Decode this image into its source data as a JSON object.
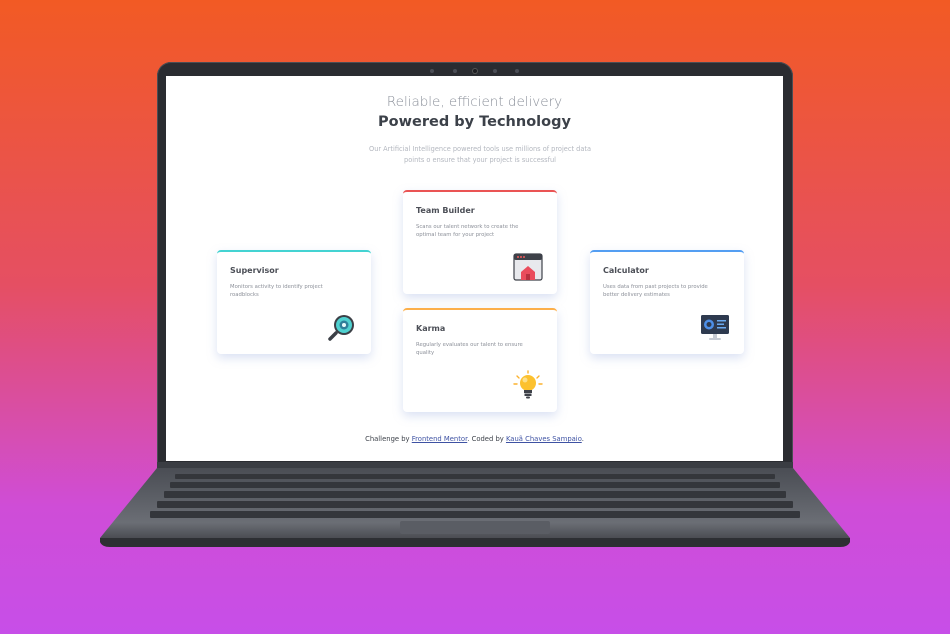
{
  "header": {
    "subtitle": "Reliable, efficient delivery",
    "title": "Powered by Technology",
    "description": "Our Artificial Intelligence powered tools use millions of project data points o ensure that your project is successful"
  },
  "cards": {
    "supervisor": {
      "title": "Supervisor",
      "text": "Monitors activity to identify project roadblocks",
      "icon": "magnifier-icon",
      "accent": "#44d3d2"
    },
    "team_builder": {
      "title": "Team Builder",
      "text": "Scans our talent network to create the optimal team for your project",
      "icon": "team-builder-icon",
      "accent": "#ea5454"
    },
    "karma": {
      "title": "Karma",
      "text": "Regularly evaluates our talent to ensure quality",
      "icon": "lightbulb-icon",
      "accent": "#fcaf4a"
    },
    "calculator": {
      "title": "Calculator",
      "text": "Uses data from past projects to provide better delivery estimates",
      "icon": "monitor-chart-icon",
      "accent": "#549ef2"
    }
  },
  "footer": {
    "prefix": "Challenge by",
    "link1": "Frontend Mentor",
    "middle": ". Coded by",
    "link2": "Kauã Chaves Sampaio",
    "suffix": "."
  }
}
